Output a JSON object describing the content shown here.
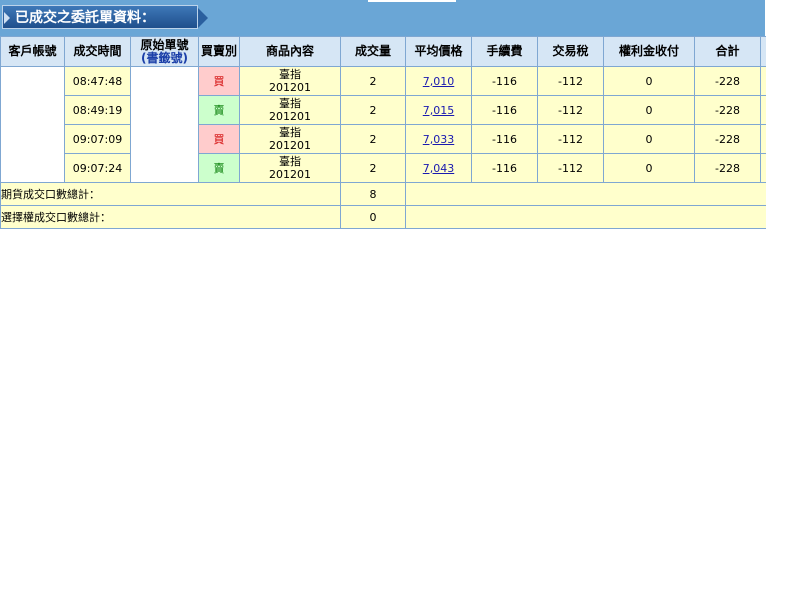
{
  "title": "已成交之委託單資料：",
  "headers": {
    "account": "客戶帳號",
    "time": "成交時間",
    "order_no_line1": "原始單號",
    "order_no_line2": "(書籤號)",
    "side": "買賣別",
    "product": "商品內容",
    "qty": "成交量",
    "avg_price": "平均價格",
    "fee": "手續費",
    "tax": "交易稅",
    "premium": "權利金收付",
    "total": "合計"
  },
  "rows": [
    {
      "time": "08:47:48",
      "side": "買",
      "side_type": "buy",
      "product_line1": "臺指",
      "product_line2": "201201",
      "qty": "2",
      "avg_price": "7,010",
      "fee": "-116",
      "tax": "-112",
      "premium": "0",
      "total": "-228"
    },
    {
      "time": "08:49:19",
      "side": "賣",
      "side_type": "sell",
      "product_line1": "臺指",
      "product_line2": "201201",
      "qty": "2",
      "avg_price": "7,015",
      "fee": "-116",
      "tax": "-112",
      "premium": "0",
      "total": "-228"
    },
    {
      "time": "09:07:09",
      "side": "買",
      "side_type": "buy",
      "product_line1": "臺指",
      "product_line2": "201201",
      "qty": "2",
      "avg_price": "7,033",
      "fee": "-116",
      "tax": "-112",
      "premium": "0",
      "total": "-228"
    },
    {
      "time": "09:07:24",
      "side": "賣",
      "side_type": "sell",
      "product_line1": "臺指",
      "product_line2": "201201",
      "qty": "2",
      "avg_price": "7,043",
      "fee": "-116",
      "tax": "-112",
      "premium": "0",
      "total": "-228"
    }
  ],
  "summary": {
    "futures_label": "期貨成交口數總計：",
    "futures_value": "8",
    "options_label": "選擇權成交口數總計：",
    "options_value": "0"
  },
  "colors": {
    "buy": "#d00000",
    "sell": "#007a00",
    "link": "#1a1ab0",
    "header_bg": "#d6e6f5",
    "row_bg": "#ffffcc"
  }
}
